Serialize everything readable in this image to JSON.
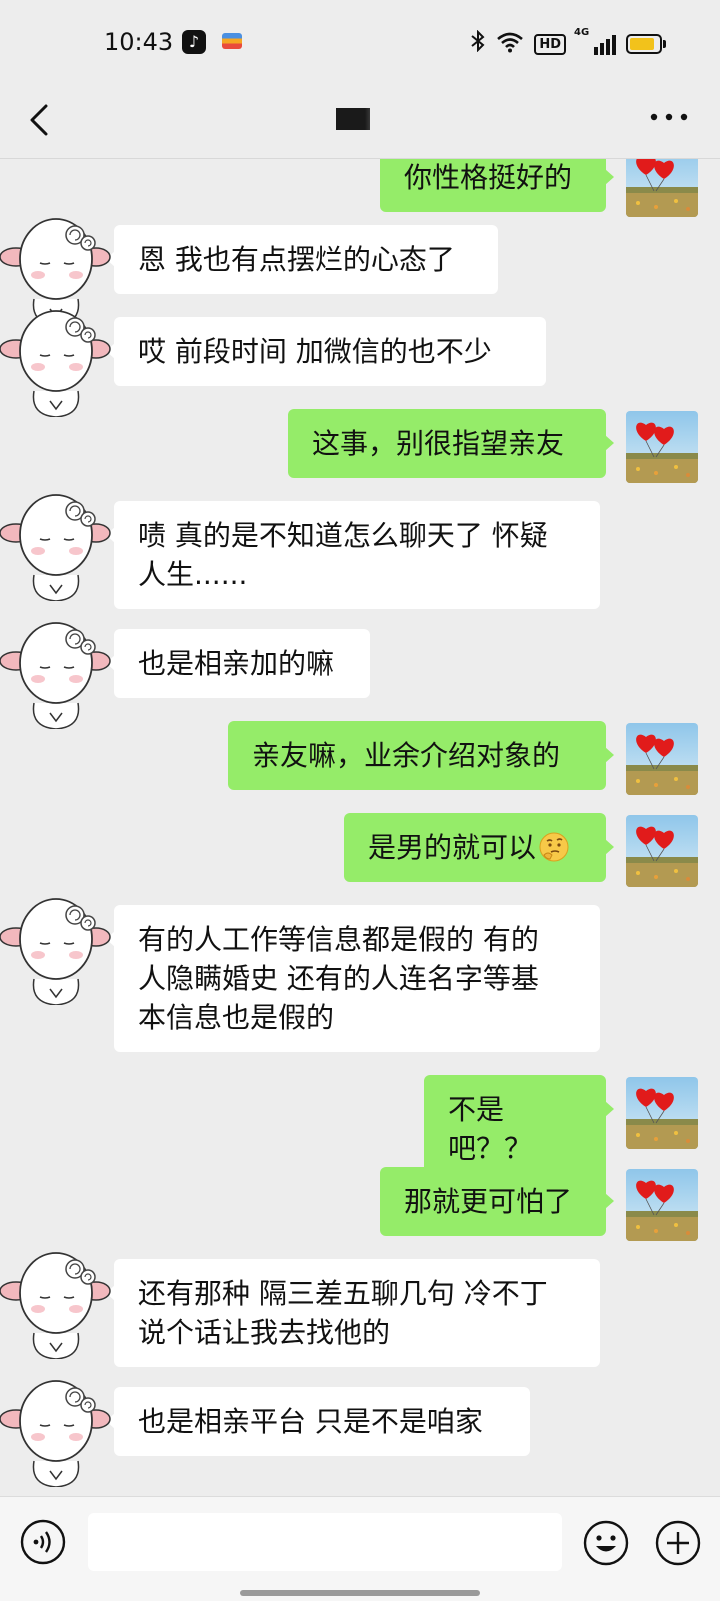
{
  "status_bar": {
    "time": "10:43",
    "network": "4G",
    "hd": "HD",
    "battery_level": 0.85,
    "battery_color": "#f2c21b"
  },
  "header": {
    "title": "",
    "back_icon": "chevron-left-icon",
    "more_icon": "more-dots-icon"
  },
  "colors": {
    "incoming_bubble": "#ffffff",
    "outgoing_bubble": "#95ec69",
    "background": "#ededed"
  },
  "messages": [
    {
      "from": "me",
      "lines": [
        "你性格挺好的"
      ]
    },
    {
      "from": "them",
      "lines": [
        "恩 我也有点摆烂的心态了"
      ]
    },
    {
      "from": "them",
      "lines": [
        "哎  前段时间 加微信的也不少"
      ]
    },
    {
      "from": "me",
      "lines": [
        "这事，别很指望亲友"
      ]
    },
    {
      "from": "them",
      "lines": [
        "啧 真的是不知道怎么聊天了 怀疑",
        "人生......"
      ]
    },
    {
      "from": "them",
      "lines": [
        "也是相亲加的嘛"
      ]
    },
    {
      "from": "me",
      "lines": [
        "亲友嘛，业余介绍对象的"
      ]
    },
    {
      "from": "me",
      "lines": [
        "是男的就可以"
      ],
      "emoji": "thinking-face-emoji"
    },
    {
      "from": "them",
      "lines": [
        "有的人工作等信息都是假的 有的",
        "人隐瞒婚史  还有的人连名字等基",
        "本信息也是假的"
      ]
    },
    {
      "from": "me",
      "lines": [
        "不是吧？？"
      ]
    },
    {
      "from": "me",
      "lines": [
        "那就更可怕了"
      ]
    },
    {
      "from": "them",
      "lines": [
        "还有那种 隔三差五聊几句 冷不丁",
        "说个话让我去找他的"
      ]
    },
    {
      "from": "them",
      "lines": [
        "也是相亲平台 只是不是咱家"
      ]
    }
  ],
  "input_bar": {
    "voice_icon": "voice-icon",
    "emoji_icon": "emoji-icon",
    "plus_icon": "plus-icon",
    "value": ""
  }
}
